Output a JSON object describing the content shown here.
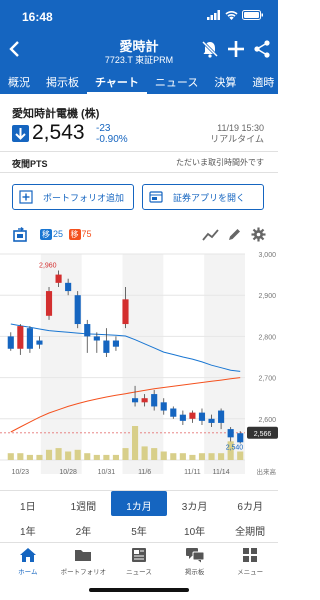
{
  "status_bar": {
    "time": "16:48"
  },
  "header": {
    "title": "愛時計",
    "subtitle": "7723.T 東証PRM"
  },
  "tabs": [
    {
      "label": "概況",
      "active": false
    },
    {
      "label": "掲示板",
      "active": false
    },
    {
      "label": "チャート",
      "active": true
    },
    {
      "label": "ニュース",
      "active": false
    },
    {
      "label": "決算",
      "active": false
    },
    {
      "label": "適時",
      "active": false
    }
  ],
  "quote": {
    "name": "愛知時計電機 (株)",
    "price": "2,543",
    "change": "-23",
    "change_pct": "-0.90%",
    "date": "11/19 15:30",
    "realtime_label": "リアルタイム"
  },
  "pts": {
    "label": "夜間PTS",
    "status": "ただいま取引時間外です"
  },
  "actions": {
    "portfolio_label": "ポートフォリオ追加",
    "app_label": "証券アプリを開く"
  },
  "chart_toolbar": {
    "ma_badge_1": "移",
    "ma_value_1": "25",
    "ma_badge_2": "移",
    "ma_value_2": "75"
  },
  "colors": {
    "brand": "#1565c0",
    "up": "#d32f2f",
    "down": "#1565c0",
    "ma25": "#1976d2",
    "ma75": "#f4511e"
  },
  "chart_data": {
    "type": "candlestick",
    "x_labels": [
      "10/23",
      "10/28",
      "10/31",
      "11/6",
      "11/11",
      "11/14"
    ],
    "y_ticks": [
      2500,
      2600,
      2700,
      2800,
      2900,
      3000
    ],
    "ylim": [
      2500,
      3000
    ],
    "annotations": {
      "high_label": "2,960",
      "low_label": "2,540",
      "last_label": "2,566",
      "volume_label": "出来高"
    },
    "candles": [
      {
        "o": 2800,
        "c": 2770,
        "h": 2810,
        "l": 2765
      },
      {
        "o": 2770,
        "c": 2825,
        "h": 2830,
        "l": 2755
      },
      {
        "o": 2820,
        "c": 2770,
        "h": 2825,
        "l": 2760
      },
      {
        "o": 2790,
        "c": 2780,
        "h": 2800,
        "l": 2770
      },
      {
        "o": 2850,
        "c": 2910,
        "h": 2920,
        "l": 2840
      },
      {
        "o": 2930,
        "c": 2950,
        "h": 2960,
        "l": 2920
      },
      {
        "o": 2930,
        "c": 2910,
        "h": 2940,
        "l": 2900
      },
      {
        "o": 2900,
        "c": 2830,
        "h": 2910,
        "l": 2820
      },
      {
        "o": 2830,
        "c": 2800,
        "h": 2840,
        "l": 2760
      },
      {
        "o": 2800,
        "c": 2790,
        "h": 2810,
        "l": 2760
      },
      {
        "o": 2790,
        "c": 2760,
        "h": 2820,
        "l": 2750
      },
      {
        "o": 2790,
        "c": 2775,
        "h": 2800,
        "l": 2765
      },
      {
        "o": 2830,
        "c": 2890,
        "h": 2920,
        "l": 2820
      },
      {
        "o": 2650,
        "c": 2640,
        "h": 2680,
        "l": 2630
      },
      {
        "o": 2640,
        "c": 2650,
        "h": 2660,
        "l": 2630
      },
      {
        "o": 2660,
        "c": 2630,
        "h": 2670,
        "l": 2620
      },
      {
        "o": 2640,
        "c": 2620,
        "h": 2650,
        "l": 2610
      },
      {
        "o": 2625,
        "c": 2605,
        "h": 2630,
        "l": 2600
      },
      {
        "o": 2610,
        "c": 2595,
        "h": 2620,
        "l": 2585
      },
      {
        "o": 2600,
        "c": 2615,
        "h": 2620,
        "l": 2590
      },
      {
        "o": 2615,
        "c": 2595,
        "h": 2625,
        "l": 2585
      },
      {
        "o": 2600,
        "c": 2590,
        "h": 2610,
        "l": 2580
      },
      {
        "o": 2620,
        "c": 2590,
        "h": 2625,
        "l": 2575
      },
      {
        "o": 2575,
        "c": 2555,
        "h": 2580,
        "l": 2545
      },
      {
        "o": 2565,
        "c": 2543,
        "h": 2570,
        "l": 2540
      }
    ],
    "ma25": [
      2830,
      2826,
      2822,
      2818,
      2814,
      2812,
      2810,
      2808,
      2806,
      2805,
      2804,
      2803,
      2801,
      2792,
      2782,
      2772,
      2762,
      2756,
      2750,
      2745,
      2738,
      2730,
      2724,
      2718,
      2715
    ],
    "ma75": [
      2568,
      2580,
      2592,
      2604,
      2614,
      2622,
      2630,
      2637,
      2643,
      2648,
      2653,
      2657,
      2661,
      2665,
      2669,
      2673,
      2676,
      2679,
      2682,
      2685,
      2688,
      2691,
      2694,
      2697,
      2700
    ],
    "volume": [
      0.2,
      0.2,
      0.15,
      0.15,
      0.3,
      0.35,
      0.25,
      0.3,
      0.2,
      0.15,
      0.15,
      0.15,
      0.35,
      1.0,
      0.4,
      0.35,
      0.25,
      0.2,
      0.2,
      0.15,
      0.2,
      0.2,
      0.2,
      0.55,
      0.25
    ]
  },
  "periods_row1": [
    "1日",
    "1週間",
    "1カ月",
    "3カ月",
    "6カ月"
  ],
  "periods_row2": [
    "1年",
    "2年",
    "5年",
    "10年",
    "全期間"
  ],
  "bottom_nav": [
    {
      "label": "ホーム",
      "icon": "home-icon",
      "active": true
    },
    {
      "label": "ポートフォリオ",
      "icon": "folder-icon",
      "active": false
    },
    {
      "label": "ニュース",
      "icon": "news-icon",
      "active": false
    },
    {
      "label": "掲示板",
      "icon": "chat-icon",
      "active": false
    },
    {
      "label": "メニュー",
      "icon": "grid-icon",
      "active": false
    }
  ]
}
